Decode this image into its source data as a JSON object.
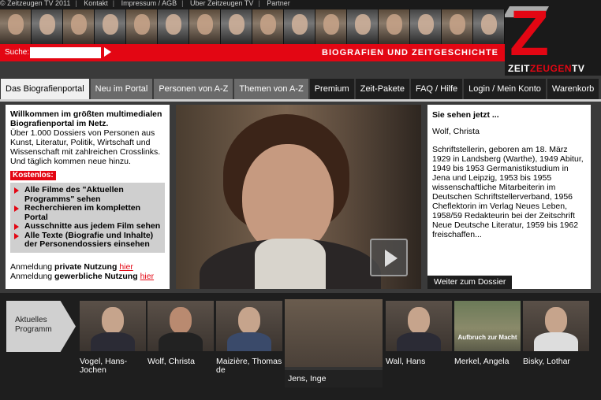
{
  "topbar": {
    "items": [
      "© Zeitzeugen TV 2011",
      "Kontakt",
      "Impressum / AGB",
      "Über Zeitzeugen TV",
      "Partner"
    ]
  },
  "header": {
    "search_label": "Suche:",
    "search_value": "",
    "tagline": "BIOGRAFIEN UND ZEITGESCHICHTE",
    "logo_letter": "Z",
    "logo_text_a": "ZEIT",
    "logo_text_b": "ZEUGEN",
    "logo_text_c": "TV"
  },
  "nav": {
    "tabs": [
      {
        "label": "Das Biografienportal",
        "state": "active"
      },
      {
        "label": "Neu im Portal",
        "state": "gray"
      },
      {
        "label": "Personen von A-Z",
        "state": "gray"
      },
      {
        "label": "Themen von A-Z",
        "state": "gray"
      },
      {
        "label": "Premium",
        "state": "dark"
      },
      {
        "label": "Zeit-Pakete",
        "state": "dark"
      },
      {
        "label": "FAQ / Hilfe",
        "state": "dark"
      },
      {
        "label": "Login / Mein Konto",
        "state": "dark"
      },
      {
        "label": "Warenkorb",
        "state": "dark"
      }
    ]
  },
  "intro": {
    "heading": "Willkommen im größten multimedialen Biografienportal im Netz.",
    "text": "Über 1.000 Dossiers von Personen aus Kunst, Literatur, Politik, Wirtschaft und Wissenschaft mit zahlreichen Crosslinks. Und täglich kommen neue hinzu.",
    "badge": "Kostenlos:",
    "features": [
      "Alle Filme des \"Aktuellen Programms\" sehen",
      "Recherchieren im kompletten Portal",
      "Ausschnitte aus jedem Film sehen",
      "Alle Texte (Biografie und Inhalte) der Personendossiers einsehen"
    ],
    "login_private_prefix": "Anmeldung ",
    "login_private_bold": "private Nutzung",
    "login_private_link": "hier",
    "login_business_prefix": "Anmeldung ",
    "login_business_bold": "gewerbliche Nutzung",
    "login_business_link": "hier"
  },
  "now_showing": {
    "heading": "Sie sehen jetzt ...",
    "name": "Wolf, Christa",
    "bio": "Schriftstellerin, geboren am 18. März 1929 in Landsberg (Warthe), 1949 Abitur, 1949 bis 1953 Germanistikstudium in Jena und Leipzig, 1953 bis 1955 wissenschaftliche Mitarbeiterin im Deutschen Schriftstellerverband, 1956 Cheflektorin im Verlag Neues Leben, 1958/59 Redakteurin bei der Zeitschrift Neue Deutsche Literatur, 1959 bis 1962 freischaffen...",
    "more_button": "Weiter zum Dossier"
  },
  "program": {
    "label_line1": "Aktuelles",
    "label_line2": "Programm",
    "cards": [
      {
        "name": "Vogel, Hans-Jochen"
      },
      {
        "name": "Wolf, Christa"
      },
      {
        "name": "Maizière, Thomas de"
      },
      {
        "name": "Jens, Inge"
      },
      {
        "name": "Wall, Hans"
      },
      {
        "name": "Merkel, Angela",
        "thumb_caption": "Aufbruch zur Macht"
      },
      {
        "name": "Bisky, Lothar"
      }
    ]
  },
  "colors": {
    "brand_red": "#e30613",
    "dark": "#1e1e1e",
    "background": "#3a3a3a"
  }
}
